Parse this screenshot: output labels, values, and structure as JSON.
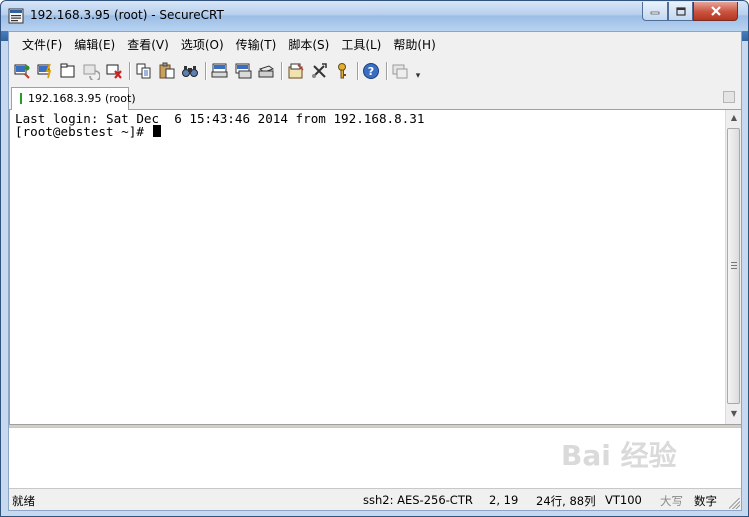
{
  "window": {
    "title": "192.168.3.95 (root) - SecureCRT",
    "minimize_icon": "minimize-icon",
    "maximize_icon": "maximize-icon",
    "close_icon": "close-icon"
  },
  "menu": {
    "items": [
      "文件(F)",
      "编辑(E)",
      "查看(V)",
      "选项(O)",
      "传输(T)",
      "脚本(S)",
      "工具(L)",
      "帮助(H)"
    ]
  },
  "toolbar": {
    "icons": [
      "connect-icon",
      "quick-connect-icon",
      "connect-in-tab-icon",
      "reconnect-icon",
      "disconnect-icon",
      "copy-icon",
      "paste-icon",
      "find-icon",
      "print-icon",
      "print-selection-icon",
      "print-setup-icon",
      "session-options-icon",
      "global-options-icon",
      "keymap-icon",
      "help-icon",
      "sftp-icon"
    ]
  },
  "tabs": [
    {
      "label": "192.168.3.95 (root)",
      "status_color": "#1fa01f"
    }
  ],
  "terminal": {
    "lines": [
      "Last login: Sat Dec  6 15:43:46 2014 from 192.168.8.31",
      "[root@ebstest ~]# "
    ]
  },
  "statusbar": {
    "ready": "就绪",
    "protocol": "ssh2: AES-256-CTR",
    "position": "2,  19",
    "size": "24行, 88列",
    "emulation": "VT100",
    "caps": "大写",
    "num": "数字"
  },
  "watermark": {
    "text": "Bai 经验"
  },
  "colors": {
    "titlebar": "#b7d0ee",
    "close_button": "#c9533f",
    "terminal_bg": "#ffffff",
    "terminal_fg": "#000000"
  }
}
